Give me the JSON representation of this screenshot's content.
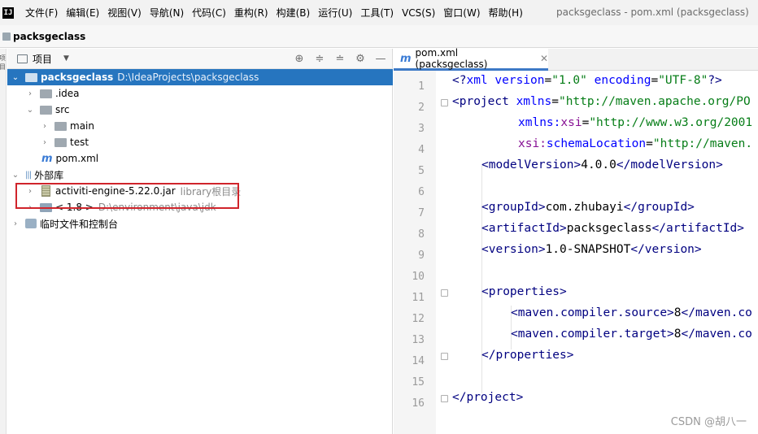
{
  "menubar": {
    "app_logo": "IJ",
    "items": [
      "文件(F)",
      "编辑(E)",
      "视图(V)",
      "导航(N)",
      "代码(C)",
      "重构(R)",
      "构建(B)",
      "运行(U)",
      "工具(T)",
      "VCS(S)",
      "窗口(W)",
      "帮助(H)"
    ],
    "window_title": "packsgeclass - pom.xml (packsgeclass)"
  },
  "navbar": {
    "project": "packsgeclass"
  },
  "toolstrip": {
    "label": "项目"
  },
  "project_panel": {
    "title": "项目",
    "dropdown": "▼",
    "actions": [
      "locate-icon",
      "expand-all-icon",
      "collapse-all-icon",
      "gear-icon",
      "minimize-icon"
    ],
    "tree": {
      "root": {
        "name": "packsgeclass",
        "path": "D:\\IdeaProjects\\packsgeclass"
      },
      "idea": ".idea",
      "src": "src",
      "main": "main",
      "test": "test",
      "pom": "pom.xml",
      "external_libraries": "外部库",
      "jar": {
        "name": "activiti-engine-5.22.0.jar",
        "note": "library根目录"
      },
      "jdk": {
        "name": "< 1.8 >",
        "path": "D:\\environment\\java\\jdk"
      },
      "scratches": "临时文件和控制台"
    }
  },
  "editor": {
    "tab": {
      "label": "pom.xml (packsgeclass)",
      "icon": "m"
    },
    "line_numbers": [
      "1",
      "2",
      "3",
      "4",
      "5",
      "6",
      "7",
      "8",
      "9",
      "10",
      "11",
      "12",
      "13",
      "14",
      "15",
      "16"
    ],
    "lines": {
      "l1": {
        "p1": "<?",
        "p2": "xml version",
        "p3": "=",
        "p4": "\"1.0\"",
        "p5": " encoding",
        "p6": "=",
        "p7": "\"UTF-8\"",
        "p8": "?>"
      },
      "l2": {
        "p1": "<project ",
        "p2": "xmlns",
        "p3": "=",
        "p4": "\"http://maven.apache.org/PO"
      },
      "l3": {
        "p1": "xmlns:",
        "p2": "xsi",
        "p3": "=",
        "p4": "\"http://www.w3.org/2001"
      },
      "l4": {
        "p1": "xsi:",
        "p2": "schemaLocation",
        "p3": "=",
        "p4": "\"http://maven."
      },
      "l5": {
        "p1": "<modelVersion>",
        "p2": "4.0.0",
        "p3": "</modelVersion>"
      },
      "l7": {
        "p1": "<groupId>",
        "p2": "com.zhubayi",
        "p3": "</groupId>"
      },
      "l8": {
        "p1": "<artifactId>",
        "p2": "packsgeclass",
        "p3": "</artifactId>"
      },
      "l9": {
        "p1": "<version>",
        "p2": "1.0-SNAPSHOT",
        "p3": "</version>"
      },
      "l11": {
        "p1": "<properties>"
      },
      "l12": {
        "p1": "<maven.compiler.source>",
        "p2": "8",
        "p3": "</maven.co"
      },
      "l13": {
        "p1": "<maven.compiler.target>",
        "p2": "8",
        "p3": "</maven.co"
      },
      "l14": {
        "p1": "</properties>"
      },
      "l16": {
        "p1": "</project>"
      }
    }
  },
  "watermark": "CSDN @胡八一"
}
